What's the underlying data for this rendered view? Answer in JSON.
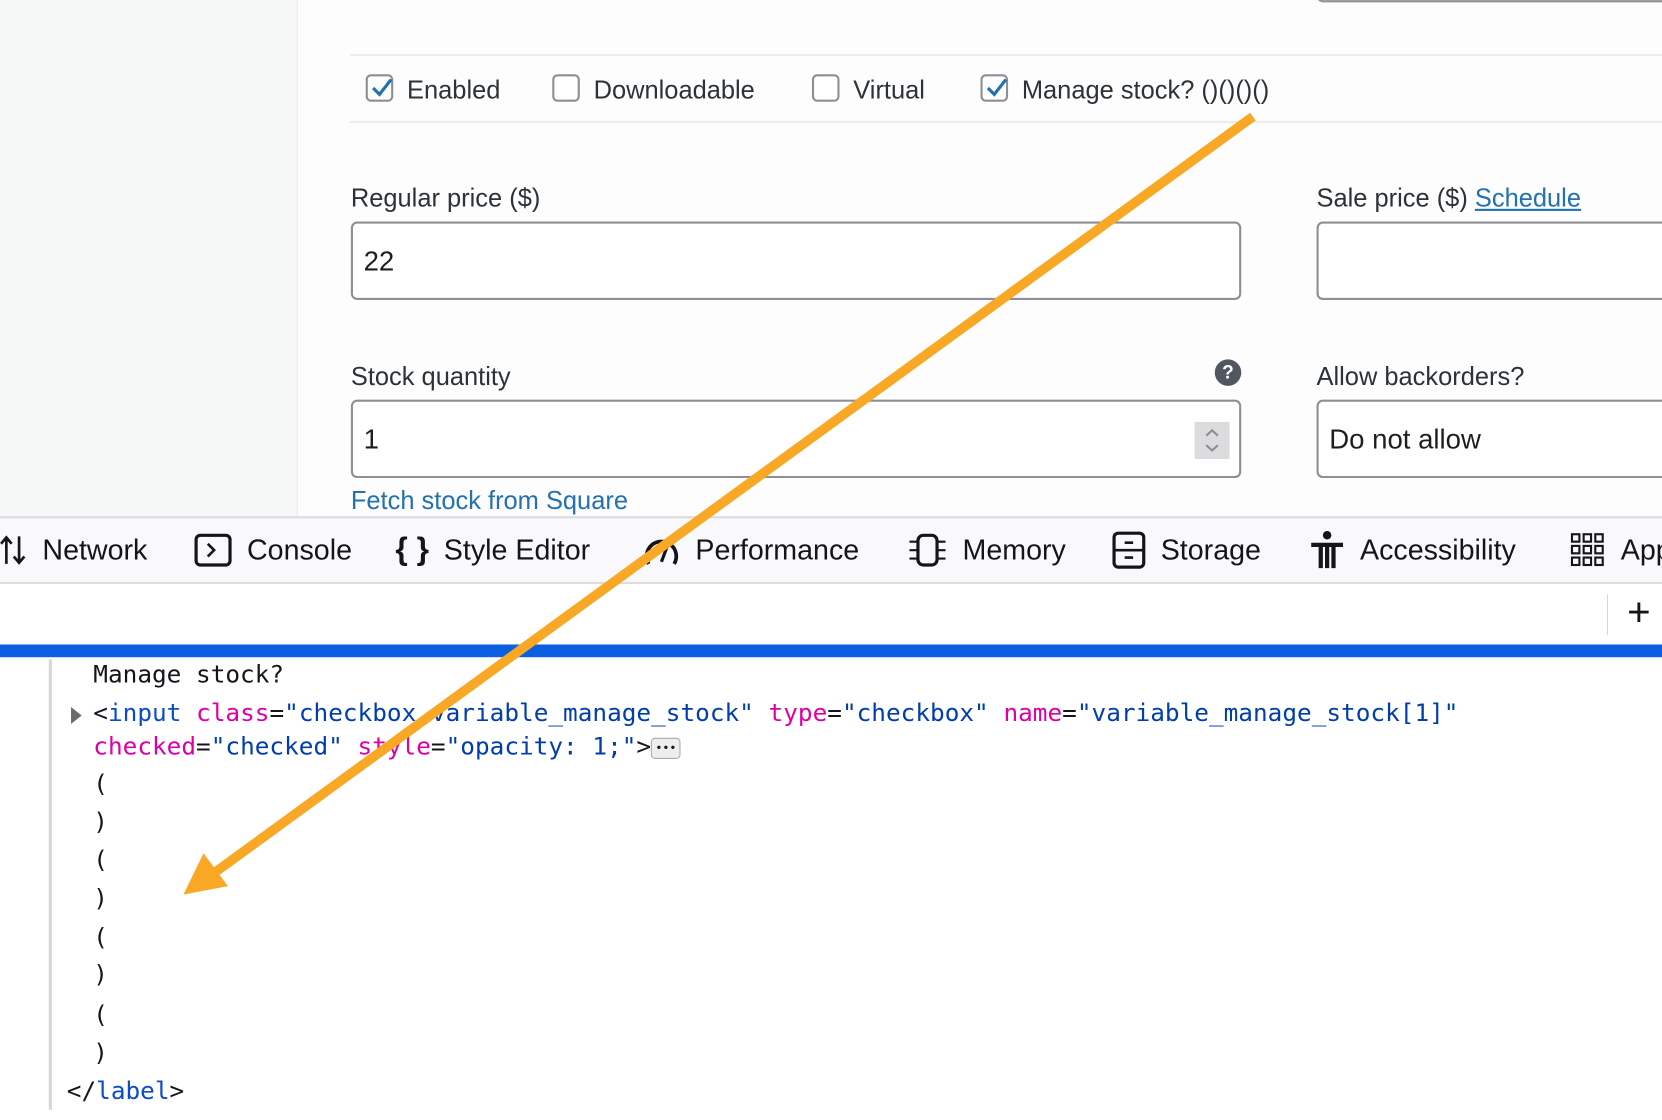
{
  "form": {
    "checkboxes": [
      {
        "label": "Enabled",
        "checked": true
      },
      {
        "label": "Downloadable",
        "checked": false
      },
      {
        "label": "Virtual",
        "checked": false
      },
      {
        "label": "Manage stock? ()()()()",
        "checked": true
      }
    ],
    "regular_price": {
      "label": "Regular price ($)",
      "value": "22"
    },
    "sale_price": {
      "label": "Sale price ($)",
      "link": "Schedule",
      "value": ""
    },
    "stock_quantity": {
      "label": "Stock quantity",
      "value": "1",
      "help": "?"
    },
    "backorders": {
      "label": "Allow backorders?",
      "value": "Do not allow"
    },
    "fetch_link": "Fetch stock from Square"
  },
  "devtools": {
    "tabs": [
      "Network",
      "Console",
      "Style Editor",
      "Performance",
      "Memory",
      "Storage",
      "Accessibility",
      "App"
    ],
    "add_label": "+",
    "code": {
      "text_line": "Manage stock?",
      "input_open": "<",
      "input_tag": "input",
      "class_attr": "class",
      "class_val": "\"checkbox variable_manage_stock\"",
      "type_attr": "type",
      "type_val": "\"checkbox\"",
      "name_attr": "name",
      "name_val": "\"variable_manage_stock[1]\"",
      "checked_attr": "checked",
      "checked_val": "\"checked\"",
      "style_attr": "style",
      "style_val": "\"opacity: 1;\"",
      "eq": "=",
      "close": ">",
      "ellipsis": "•••",
      "parens": [
        "(",
        ")",
        "(",
        ")",
        "(",
        ")",
        "(",
        ")"
      ],
      "end_open": "</",
      "end_tag": "label",
      "end_close": ">"
    }
  },
  "annotation": {
    "arrow_color": "#f9a825"
  }
}
